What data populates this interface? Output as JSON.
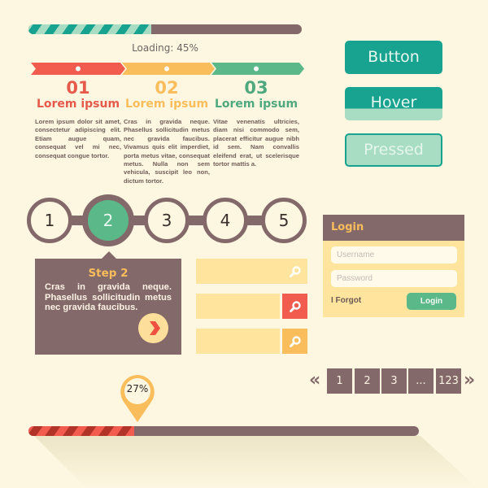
{
  "top_progress": {
    "label": "Loading: 45%",
    "value_percent": 45,
    "fill_color": "#17a38f",
    "track_color": "#84696a"
  },
  "steps_ribbon": [
    {
      "number": "01",
      "title": "Lorem ipsum",
      "color": "#f25c4e",
      "text": "Lorem ipsum dolor sit amet, consectetur adipiscing elit. Etiam augue quam, consequat vel mi nec, consequat congue tortor."
    },
    {
      "number": "02",
      "title": "Lorem ipsum",
      "color": "#f9bd5b",
      "text": "Cras in gravida neque. Phasellus sollicitudin metus nec gravida faucibus. Vivamus quis elit imperdiet, porta metus vitae, consequat metus. Nulla non sem vehicula, suscipit leo non, dictum tortor."
    },
    {
      "number": "03",
      "title": "Lorem ipsum",
      "color": "#5ab889",
      "text": "Vitae venenatis ultricies, diam nisi commodo sem, placerat efficitur augue nibh id sem. Nam convallis eleifend erat, ut scelerisque tortor mattis a."
    }
  ],
  "buttons": {
    "normal": "Button",
    "hover": "Hover",
    "pressed": "Pressed"
  },
  "stepper": {
    "steps": [
      "1",
      "2",
      "3",
      "4",
      "5"
    ],
    "active_index": 1,
    "popover": {
      "title": "Step 2",
      "text": "Cras in gravida neque. Phasellus sollicitudin metus nec gravida faucibus.",
      "next_icon": "chevron-right"
    }
  },
  "search_fields": [
    {
      "placeholder": "",
      "value": "",
      "button_color": "#fee49d",
      "icon": "search-icon"
    },
    {
      "placeholder": "",
      "value": "",
      "button_color": "#f25c4e",
      "icon": "search-icon"
    },
    {
      "placeholder": "",
      "value": "",
      "button_color": "#f9bd5b",
      "icon": "search-icon"
    }
  ],
  "login": {
    "title": "Login",
    "username_placeholder": "Username",
    "password_placeholder": "Password",
    "forgot_label": "I Forgot",
    "submit_label": "Login"
  },
  "pagination": {
    "prev_icon": "«",
    "next_icon": "»",
    "pages": [
      "1",
      "2",
      "3",
      "...",
      "123"
    ]
  },
  "bottom_progress": {
    "label": "27%",
    "value_percent": 27,
    "fill_color": "#f25c4e",
    "track_color": "#84696a"
  }
}
